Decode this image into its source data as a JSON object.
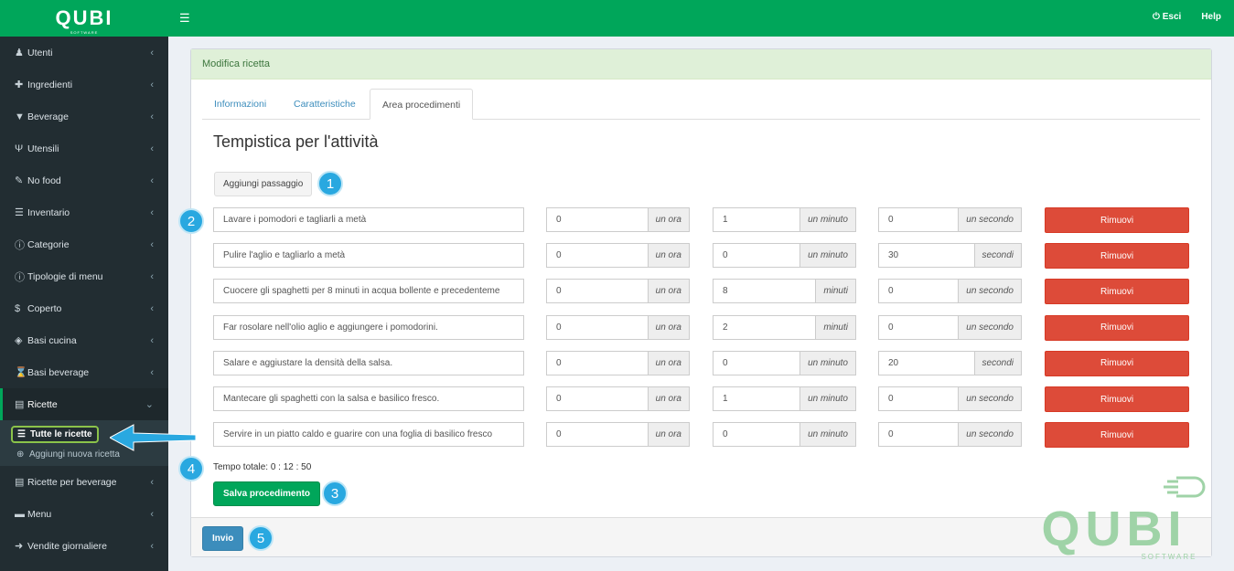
{
  "brand": {
    "logo": "QUBI",
    "sub": "SOFTWARE"
  },
  "topbar": {
    "logout": "Esci",
    "help": "Help"
  },
  "sidebar": {
    "items": [
      {
        "label": "Utenti",
        "icon": "user-icon"
      },
      {
        "label": "Ingredienti",
        "icon": "puzzle-icon"
      },
      {
        "label": "Beverage",
        "icon": "filter-icon"
      },
      {
        "label": "Utensili",
        "icon": "cutlery-icon"
      },
      {
        "label": "No food",
        "icon": "wrench-icon"
      },
      {
        "label": "Inventario",
        "icon": "list-icon"
      },
      {
        "label": "Categorie",
        "icon": "info-icon"
      },
      {
        "label": "Tipologie di menu",
        "icon": "info-icon"
      },
      {
        "label": "Coperto",
        "icon": "dollar-icon"
      },
      {
        "label": "Basi cucina",
        "icon": "cube-icon"
      },
      {
        "label": "Basi beverage",
        "icon": "hourglass-icon"
      },
      {
        "label": "Ricette",
        "icon": "file-icon"
      },
      {
        "label": "Ricette per beverage",
        "icon": "file-text-icon"
      },
      {
        "label": "Menu",
        "icon": "card-icon"
      },
      {
        "label": "Vendite giornaliere",
        "icon": "arrow-circle-icon"
      }
    ],
    "sub": {
      "all": "Tutte le ricette",
      "new": "Aggiungi nuova ricetta"
    }
  },
  "box": {
    "title": "Modifica ricetta"
  },
  "tabs": [
    "Informazioni",
    "Caratteristiche",
    "Area procedimenti"
  ],
  "section_title": "Tempistica per l'attività",
  "add_step": "Aggiungi passaggio",
  "remove_label": "Rimuovi",
  "steps": [
    {
      "text": "Lavare i pomodori e tagliarli a metà",
      "h": "0",
      "h_unit": "un ora",
      "m": "1",
      "m_unit": "un minuto",
      "s": "0",
      "s_unit": "un secondo"
    },
    {
      "text": "Pulire l'aglio e tagliarlo a metà",
      "h": "0",
      "h_unit": "un ora",
      "m": "0",
      "m_unit": "un minuto",
      "s": "30",
      "s_unit": "secondi"
    },
    {
      "text": "Cuocere gli spaghetti per 8 minuti in acqua bollente e precedenteme",
      "h": "0",
      "h_unit": "un ora",
      "m": "8",
      "m_unit": "minuti",
      "s": "0",
      "s_unit": "un secondo"
    },
    {
      "text": "Far rosolare nell'olio aglio e aggiungere i pomodorini.",
      "h": "0",
      "h_unit": "un ora",
      "m": "2",
      "m_unit": "minuti",
      "s": "0",
      "s_unit": "un secondo"
    },
    {
      "text": "Salare e aggiustare la densità della salsa.",
      "h": "0",
      "h_unit": "un ora",
      "m": "0",
      "m_unit": "un minuto",
      "s": "20",
      "s_unit": "secondi"
    },
    {
      "text": "Mantecare gli spaghetti con la salsa e basilico fresco.",
      "h": "0",
      "h_unit": "un ora",
      "m": "1",
      "m_unit": "un minuto",
      "s": "0",
      "s_unit": "un secondo"
    },
    {
      "text": "Servire in un piatto caldo e guarire con una foglia di basilico fresco",
      "h": "0",
      "h_unit": "un ora",
      "m": "0",
      "m_unit": "un minuto",
      "s": "0",
      "s_unit": "un secondo"
    }
  ],
  "total": "Tempo totale: 0 : 12 : 50",
  "save": "Salva procedimento",
  "submit": "Invio",
  "badges": [
    "1",
    "2",
    "3",
    "4",
    "5"
  ],
  "colors": {
    "green": "#00a65a",
    "red": "#dd4b39",
    "blue": "#3c8dbc",
    "badge": "#29a8e0"
  }
}
